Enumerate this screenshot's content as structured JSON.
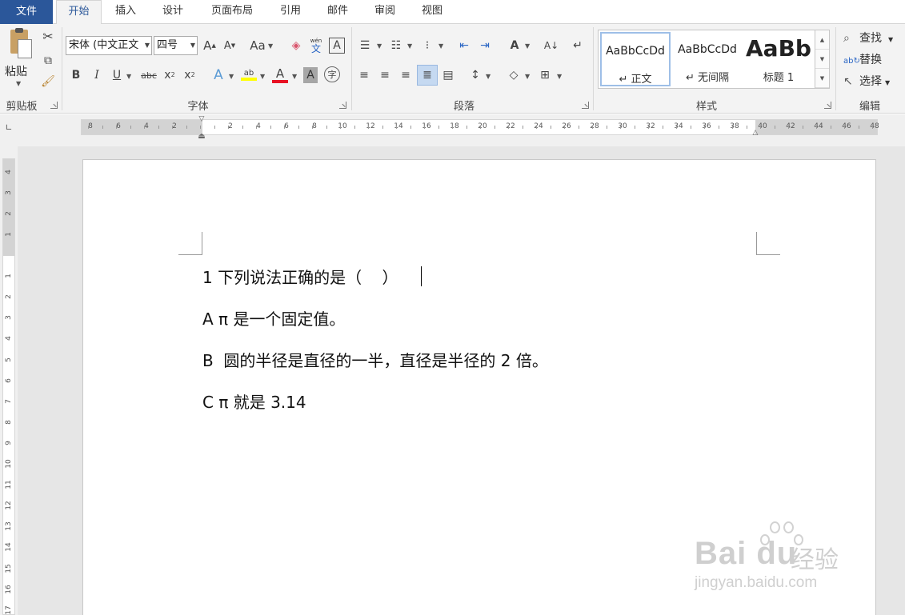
{
  "tabs": {
    "file": "文件",
    "items": [
      "开始",
      "插入",
      "设计",
      "页面布局",
      "引用",
      "邮件",
      "审阅",
      "视图"
    ]
  },
  "ribbon": {
    "clipboard": {
      "paste": "粘贴",
      "label": "剪贴板"
    },
    "font": {
      "name": "宋体 (中文正文",
      "size": "四号",
      "label": "字体",
      "change_case": "Aa",
      "phonetic_top": "wén",
      "phonetic_bottom": "文",
      "font_color": "#e81123",
      "highlight_color": "#ffff00"
    },
    "paragraph": {
      "label": "段落"
    },
    "styles": {
      "label": "样式",
      "items": [
        {
          "sample": "AaBbCcDd",
          "name": "↵ 正文"
        },
        {
          "sample": "AaBbCcDd",
          "name": "↵ 无间隔"
        },
        {
          "sample": "AaBb",
          "name": "标题 1"
        }
      ]
    },
    "editing": {
      "label": "编辑",
      "find": "查找",
      "replace": "替换",
      "select": "选择"
    }
  },
  "ruler": {
    "h_left_numbers": [
      "8",
      "6",
      "4",
      "2"
    ],
    "h_right_numbers": [
      "2",
      "4",
      "6",
      "8",
      "10",
      "12",
      "14",
      "16",
      "18",
      "20",
      "22",
      "24",
      "26",
      "28",
      "30",
      "32",
      "34",
      "36",
      "38",
      "40",
      "42",
      "44",
      "46",
      "48"
    ],
    "v_top_numbers": [
      "4",
      "3",
      "2",
      "1"
    ],
    "v_numbers": [
      "1",
      "2",
      "3",
      "4",
      "5",
      "6",
      "7",
      "8",
      "9",
      "10",
      "11",
      "12",
      "13",
      "14",
      "15",
      "16",
      "17"
    ]
  },
  "document": {
    "paragraphs": [
      "1 下列说法正确的是（    ）",
      "A π 是一个固定值。",
      "B  圆的半径是直径的一半，直径是半径的 2 倍。",
      "C π 就是 3.14"
    ]
  },
  "watermark": {
    "logo": "Bai du",
    "cn": "经验",
    "url": "jingyan.baidu.com"
  }
}
